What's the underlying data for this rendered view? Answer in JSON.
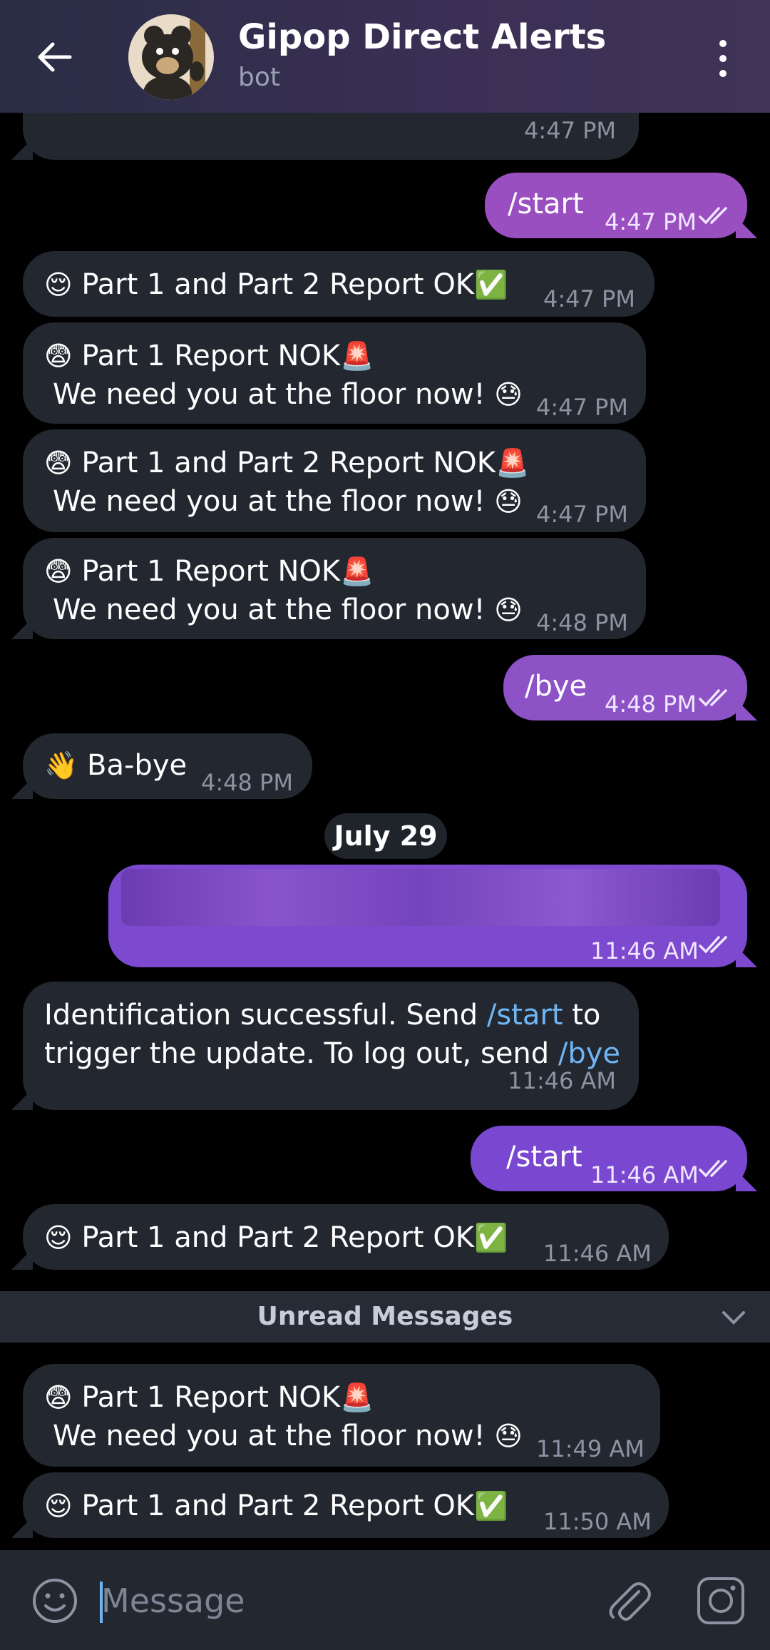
{
  "header": {
    "title": "Gipop Direct Alerts",
    "subtitle": "bot"
  },
  "messages": [
    {
      "time": "4:47 PM"
    },
    {
      "text": "/start",
      "time": "4:47 PM"
    },
    {
      "emoji": "😌",
      "text": "Part 1 and Part 2 Report OK",
      "suffix": "✅",
      "time": "4:47 PM"
    },
    {
      "emoji": "😨",
      "line1": "Part 1 Report NOK",
      "siren": "🚨",
      "line2": "We need you at the floor now!",
      "sweat": "😓",
      "time": "4:47 PM"
    },
    {
      "emoji": "😨",
      "line1": "Part 1 and Part 2 Report NOK",
      "siren": "🚨",
      "line2": "We need you at the floor now!",
      "sweat": "😓",
      "time": "4:47 PM"
    },
    {
      "emoji": "😨",
      "line1": "Part 1 Report NOK",
      "siren": "🚨",
      "line2": "We need you at the floor now!",
      "sweat": "😓",
      "time": "4:48 PM"
    },
    {
      "text": "/bye",
      "time": "4:48 PM"
    },
    {
      "emoji": "👋",
      "text": "Ba-bye",
      "time": "4:48 PM"
    },
    {
      "date": "July 29"
    },
    {
      "time": "11:46 AM"
    },
    {
      "part1": "Identification successful. Send ",
      "link1": "/start",
      "part2": " to",
      "part3": "trigger the update. To log out, send ",
      "link2": "/bye",
      "time": "11:46 AM"
    },
    {
      "text": "/start",
      "time": "11:46 AM"
    },
    {
      "emoji": "😌",
      "text": "Part 1 and Part 2 Report OK",
      "suffix": "✅",
      "time": "11:46 AM"
    },
    {
      "emoji": "😨",
      "line1": "Part 1 Report NOK",
      "siren": "🚨",
      "line2": "We need you at the floor now!",
      "sweat": "😓",
      "time": "11:49 AM"
    },
    {
      "emoji": "😌",
      "text": "Part 1 and Part 2 Report OK",
      "suffix": "✅",
      "time": "11:50 AM"
    }
  ],
  "unread_label": "Unread Messages",
  "input": {
    "placeholder": "Message"
  },
  "icons": [
    "back-arrow-icon",
    "more-vertical-icon",
    "emoji-icon",
    "attach-icon",
    "camera-icon",
    "double-check-icon"
  ]
}
